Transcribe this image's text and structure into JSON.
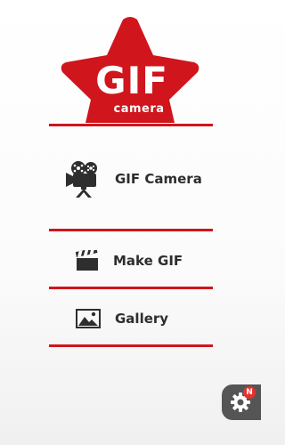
{
  "logo": {
    "title": "GIF",
    "subtitle": "camera"
  },
  "menu": {
    "items": [
      {
        "label": "GIF Camera",
        "icon": "movie-camera-icon"
      },
      {
        "label": "Make GIF",
        "icon": "clapperboard-icon"
      },
      {
        "label": "Gallery",
        "icon": "image-gallery-icon"
      }
    ]
  },
  "settings": {
    "icon": "gear-icon",
    "badge": "N"
  },
  "colors": {
    "accent": "#d0151c",
    "text": "#2e2e2e",
    "settings_bg": "#555555",
    "badge": "#e8302d"
  }
}
